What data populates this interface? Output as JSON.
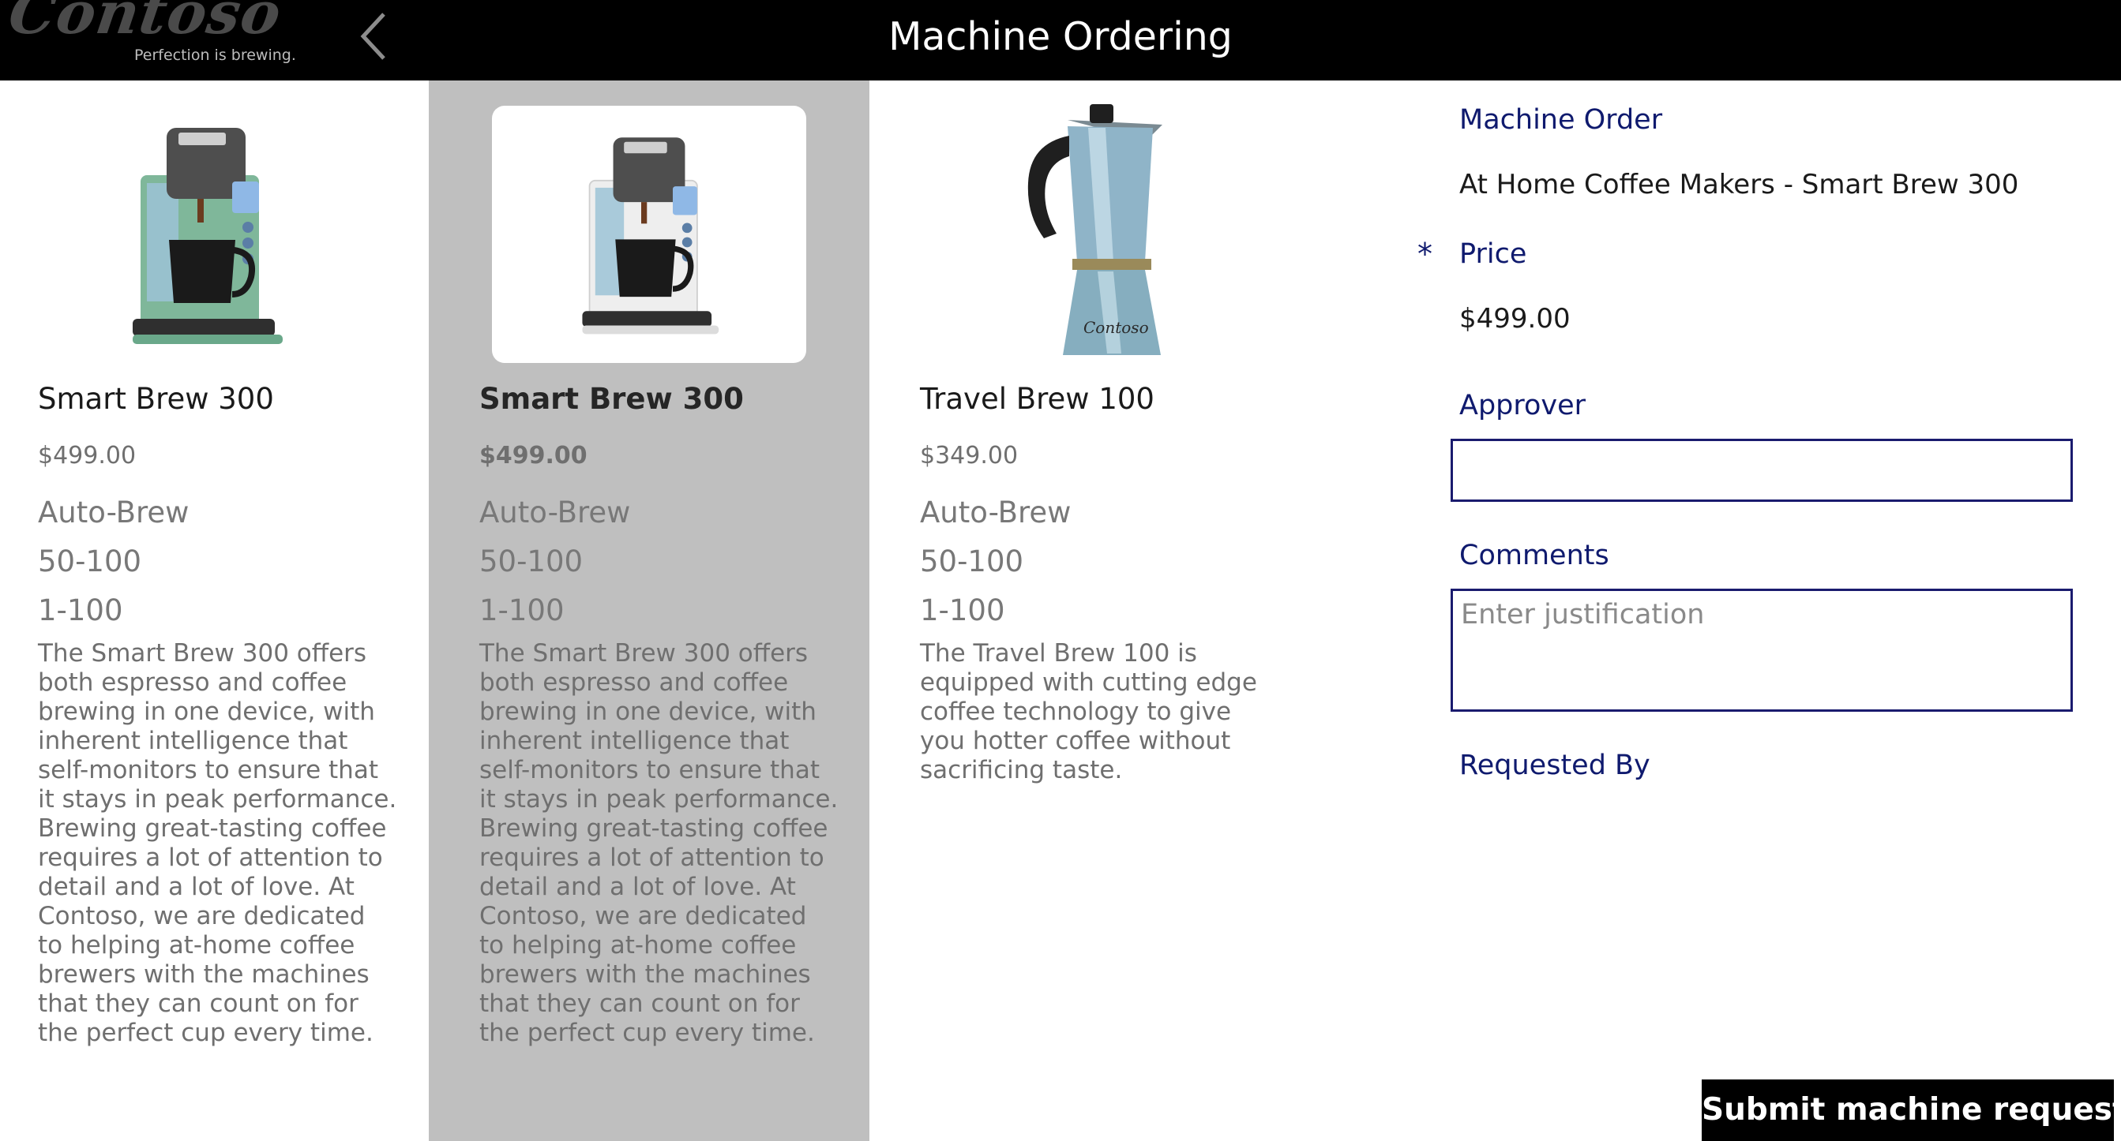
{
  "app": {
    "title": "Machine Ordering",
    "logo_text": "Contoso",
    "logo_tagline": "Perfection is brewing."
  },
  "colors": {
    "header_bg": "#000000",
    "selected_item_bg": "#bfbfbf",
    "form_label": "#0f1a6e",
    "input_border": "#1a1b6e"
  },
  "gallery": {
    "items": [
      {
        "name": "Smart Brew 300",
        "price": "$499.00",
        "spec1": "Auto-Brew",
        "spec2": "50-100",
        "spec3": "1-100",
        "description": "The Smart Brew 300 offers both espresso and coffee brewing in one device, with inherent intelligence that self-monitors to ensure that it stays in peak performance. Brewing great-tasting coffee requires a lot of attention to detail and a lot of love. At Contoso, we are dedicated to helping at-home coffee brewers with the machines that they can count on for the perfect cup every time.",
        "image_icon": "coffee-machine-green-icon"
      },
      {
        "name": "Smart Brew 300",
        "price": "$499.00",
        "spec1": "Auto-Brew",
        "spec2": "50-100",
        "spec3": "1-100",
        "description": "The Smart Brew 300 offers both espresso and coffee brewing in one device, with inherent intelligence that self-monitors to ensure that it stays in peak performance. Brewing great-tasting coffee requires a lot of attention to detail and a lot of love. At Contoso, we are dedicated to helping at-home coffee brewers with the machines that they can count on for the perfect cup every time.",
        "image_icon": "coffee-machine-white-icon",
        "selected": true
      },
      {
        "name": "Travel Brew 100",
        "price": "$349.00",
        "spec1": "Auto-Brew",
        "spec2": "50-100",
        "spec3": "1-100",
        "description": "The Travel Brew 100 is equipped with cutting edge coffee technology to give you hotter coffee without sacrificing taste.",
        "image_icon": "moka-pot-icon",
        "image_text": "Contoso"
      }
    ]
  },
  "form": {
    "machine_order_label": "Machine Order",
    "machine_order_value": "At Home Coffee Makers - Smart Brew 300",
    "price_required_marker": "*",
    "price_label": "Price",
    "price_value": "$499.00",
    "approver_label": "Approver",
    "approver_value": "",
    "comments_label": "Comments",
    "comments_placeholder": "Enter justification",
    "requested_by_label": "Requested By",
    "submit_label": "Submit machine request"
  }
}
